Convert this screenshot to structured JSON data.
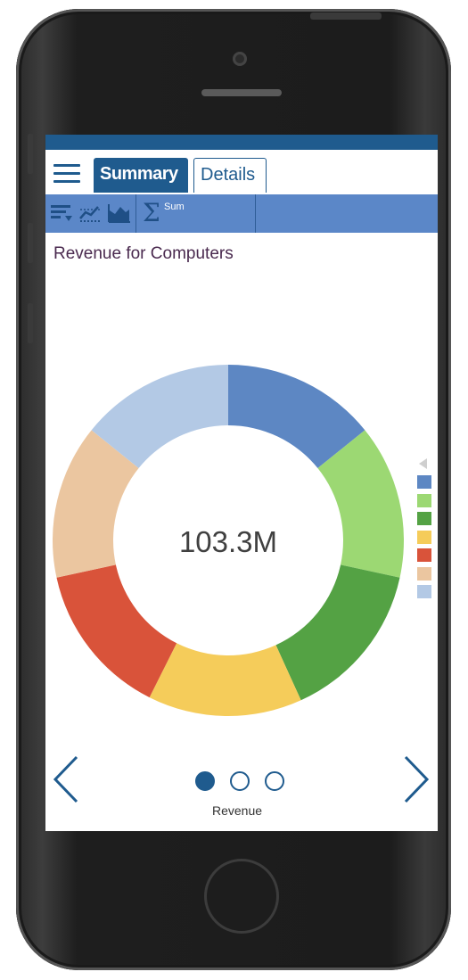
{
  "tabs": {
    "summary_label": "Summary",
    "details_label": "Details"
  },
  "toolbar": {
    "sum_label": "Sum",
    "icons": [
      "sort-icon",
      "line-chart-icon",
      "area-chart-icon",
      "sigma-icon"
    ]
  },
  "chart": {
    "title": "Revenue for Computers",
    "center_value": "103.3M"
  },
  "chart_data": {
    "type": "pie",
    "title": "Revenue for Computers",
    "center_label": "103.3M",
    "categories": [
      "",
      "",
      "",
      "",
      "",
      "",
      ""
    ],
    "values": [
      14.2,
      14.2,
      14.8,
      14.2,
      14.2,
      14.2,
      14.2
    ],
    "colors": [
      "#5d87c3",
      "#9cd873",
      "#54a244",
      "#f5cc5a",
      "#d9533a",
      "#ebc6a0",
      "#b3c9e5"
    ],
    "legend": "right"
  },
  "pager": {
    "label": "Revenue",
    "pages": 3,
    "current": 1
  },
  "colors": {
    "brand": "#1f5b8e",
    "toolbar": "#5b87c8"
  }
}
